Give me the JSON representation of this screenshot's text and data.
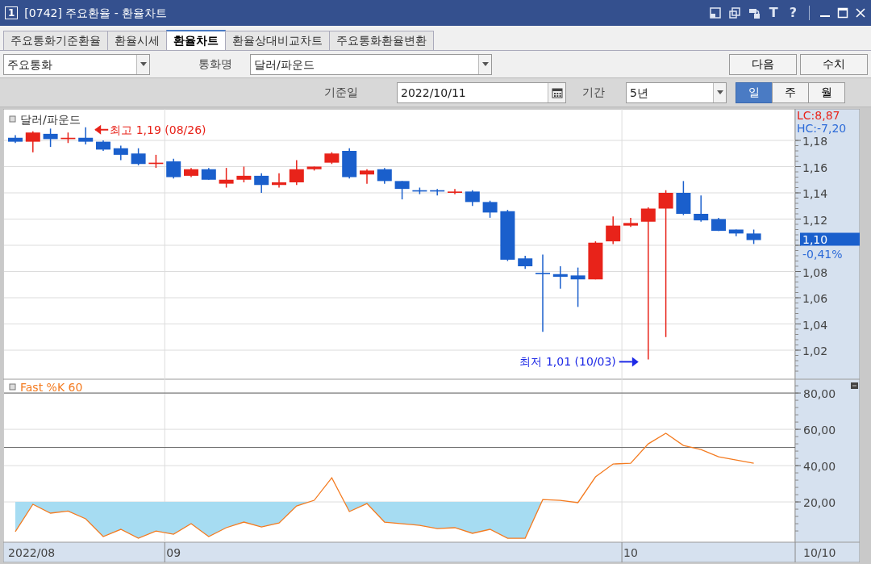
{
  "window": {
    "badge": "1",
    "title": "[0742] 주요환율 - 환율차트",
    "tool_glyphs": [
      "T",
      "?"
    ]
  },
  "tabs": [
    {
      "label": "주요통화기준환율",
      "selected": false
    },
    {
      "label": "환율시세",
      "selected": false
    },
    {
      "label": "환율차트",
      "selected": true
    },
    {
      "label": "환율상대비교차트",
      "selected": false
    },
    {
      "label": "주요통화환율변환",
      "selected": false
    }
  ],
  "filters": {
    "category": "주요통화",
    "currency_label": "통화명",
    "currency": "달러/파운드",
    "buttons": [
      "다음",
      "수치"
    ]
  },
  "query": {
    "date_label": "기준일",
    "date": "2022/10/11",
    "period_label": "기간",
    "period": "5년",
    "intervals": [
      {
        "label": "일",
        "selected": true
      },
      {
        "label": "주",
        "selected": false
      },
      {
        "label": "월",
        "selected": false
      }
    ]
  },
  "price_chart": {
    "legend": "달러/파운드",
    "lc": "LC:8,87",
    "hc": "HC:-7,20",
    "last_price": "1,10",
    "change": "-0,41%",
    "high_note": "최고 1,19 (08/26)",
    "low_note": "최저 1,01 (10/03)",
    "axis_labels": [
      "1,18",
      "1,16",
      "1,14",
      "1,12",
      "1,08",
      "1,06",
      "1,04",
      "1,02"
    ]
  },
  "indicator_chart": {
    "chart_data": {
      "type": "line",
      "ylim": [
        -2.2,
        87.6
      ],
      "grid": true,
      "yticks": [
        {
          "value": 20,
          "label": "20,00"
        },
        {
          "value": 40,
          "label": "40,00"
        },
        {
          "value": 60,
          "label": "60,00"
        },
        {
          "value": 80,
          "label": "80,00"
        }
      ],
      "series": [
        {
          "name": "Fast %K 60",
          "color": "#f47b20",
          "values": [
            3.6,
            18.7,
            13.8,
            15.0,
            10.7,
            0.9,
            4.9,
            0.0,
            4.0,
            2.2,
            8.0,
            0.9,
            5.8,
            8.9,
            6.2,
            8.4,
            17.8,
            20.9,
            33.3,
            14.7,
            19.1,
            8.9,
            8.0,
            7.1,
            5.3,
            5.8,
            2.7,
            4.9,
            0.0,
            0.0,
            21.3,
            20.9,
            19.6,
            33.8,
            40.9,
            41.3,
            52.0,
            57.8,
            51.1,
            48.9,
            44.9,
            43.1,
            41.3
          ]
        }
      ],
      "ref_lines": [
        {
          "axis": "y",
          "value": 80
        },
        {
          "axis": "y",
          "value": 50
        }
      ]
    }
  },
  "x_axis": {
    "labels": [
      "2022/08",
      "09",
      "10"
    ],
    "last_date": "10/10"
  }
}
